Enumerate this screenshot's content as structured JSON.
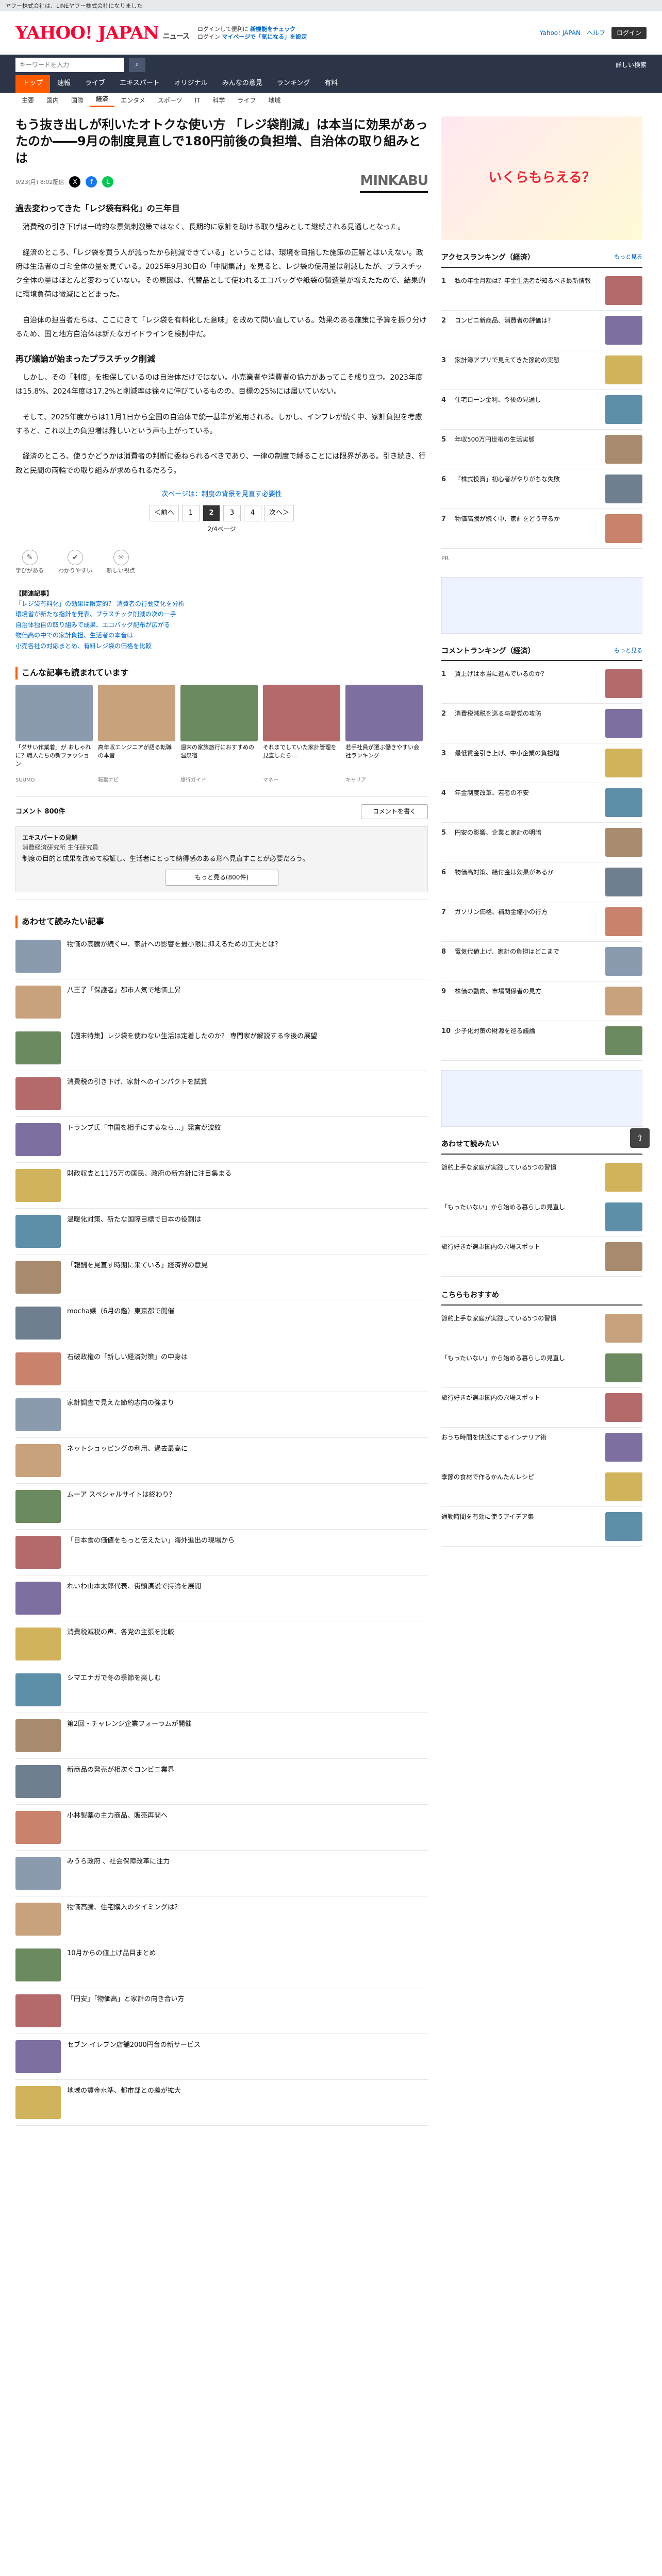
{
  "top_bar": "ヤフー株式会社は、LINEヤフー株式会社になりました",
  "header": {
    "logo": "YAHOO! JAPAN",
    "logo_sub": "ニュース",
    "promo1": "ログインして便利に",
    "promo1_b": "新機能をチェック",
    "promo2": "ログイン",
    "promo2_b": "マイページで「気になる」を設定",
    "right1": "Yahoo! JAPAN",
    "right2": "ヘルプ",
    "right_btn": "ログイン"
  },
  "search": {
    "placeholder": "キーワードを入力",
    "button": "検索",
    "option": "詳しい検索"
  },
  "nav1": [
    "トップ",
    "速報",
    "ライブ",
    "エキスパート",
    "オリジナル",
    "みんなの意見",
    "ランキング",
    "有料"
  ],
  "nav2": [
    "主要",
    "国内",
    "国際",
    "経済",
    "エンタメ",
    "スポーツ",
    "IT",
    "科学",
    "ライフ",
    "地域"
  ],
  "article": {
    "title": "もう抜き出しが利いたオトクな使い方 「レジ袋削減」は本当に効果があったのか――9月の制度見直しで180円前後の負担増、自治体の取り組みとは",
    "date": "9/23(月) 8:02配信",
    "source": "MINKABU",
    "h1": "過去変わってきた「レジ袋有料化」の三年目",
    "p1": "消費税の引き下げは一時的な景気刺激策ではなく、長期的に家計を助ける取り組みとして継続される見通しとなった。",
    "p2": "経済のところ、「レジ袋を買う人が減ったから削減できている」ということは、環境を目指した施策の正解とはいえない。政府は生活者のゴミ全体の量を見ている。2025年9月30日の「中間集計」を見ると、レジ袋の使用量は削減したが、プラスチック全体の量はほとんど変わっていない。その原因は、代替品として使われるエコバッグや紙袋の製造量が増えたためで、結果的に環境負荷は微減にとどまった。",
    "p3": "自治体の担当者たちは、ここにきて「レジ袋を有料化した意味」を改めて問い直している。効果のある施策に予算を振り分けるため、国と地方自治体は新たなガイドラインを検討中だ。",
    "h2": "再び議論が始まったプラスチック削減",
    "p4": "しかし、その「制度」を担保しているのは自治体だけではない。小売業者や消費者の協力があってこそ成り立つ。2023年度は15.8%、2024年度は17.2%と削減率は徐々に伸びているものの、目標の25%には届いていない。",
    "p5": "そして、2025年度からは11月1日から全国の自治体で統一基準が適用される。しかし、インフレが続く中、家計負担を考慮すると、これ以上の負担増は難しいという声も上がっている。",
    "p6": "経済のところ、使うかどうかは消費者の判断に委ねられるべきであり、一律の制度で縛ることには限界がある。引き続き、行政と民間の両輪での取り組みが求められるだろう。",
    "continue": "次ページは：制度の背景を見直す必要性",
    "pages": [
      "＜前へ",
      "1",
      "2",
      "3",
      "4",
      "次へ＞"
    ],
    "page_count": "2/4ページ",
    "reactions": [
      "学びがある",
      "わかりやすい",
      "新しい視点"
    ],
    "links_head": "【関連記事】",
    "links": [
      "「レジ袋有料化」の効果は限定的？ 消費者の行動変化を分析",
      "環境省が新たな指針を発表、プラスチック削減の次の一手",
      "自治体独自の取り組みで成果、エコバッグ配布が広がる",
      "物価高の中での家計負担、生活者の本音は",
      "小売各社の対応まとめ、有料レジ袋の価格を比較"
    ],
    "photos_head": "こんな記事も読まれています",
    "photos": [
      {
        "cap": "「ダサい作業着」が おしゃれに？職人たちの新ファッション",
        "src": "SUUMO"
      },
      {
        "cap": "高年収エンジニアが語る転職の本音",
        "src": "転職ナビ"
      },
      {
        "cap": "週末の家族旅行におすすめの温泉宿",
        "src": "旅行ガイド"
      },
      {
        "cap": "それまでしていた家計管理を見直したら…",
        "src": "マネー"
      },
      {
        "cap": "若手社員が選ぶ働きやすい会社ランキング",
        "src": "キャリア"
      }
    ],
    "comment_label": "コメント 800件",
    "comment_btn": "コメントを書く",
    "expert_head": "エキスパートの見解",
    "expert_name": "消費経済研究所 主任研究員",
    "expert_text": "制度の目的と成果を改めて検証し、生活者にとって納得感のある形へ見直すことが必要だろう。",
    "expert_more": "もっと見る(800件)",
    "related_head": "あわせて読みたい記事"
  },
  "related": [
    "物価の高騰が続く中、家計への影響を最小限に抑えるための工夫とは？",
    "八王子「保護者」都市人気で地価上昇",
    "【週末特集】レジ袋を使わない生活は定着したのか？ 専門家が解説する今後の展望",
    "消費税の引き下げ、家計へのインパクトを試算",
    "トランプ氏「中国を相手にするなら…」発言が波紋",
    "財政収支と1175万の国民、政府の新方針に注目集まる",
    "温暖化対策、新たな国際目標で日本の役割は",
    "「報酬を見直す時期に来ている」経済界の意見",
    "mocha嬢（6月の鑑）東京都で開催",
    "石破政権の「新しい経済対策」の中身は",
    "家計調査で見えた節約志向の強まり",
    "ネットショッピングの利用、過去最高に",
    "ムーア スペシャルサイトは終わり？",
    "「日本食の価値をもっと伝えたい」海外進出の現場から",
    "れいわ山本太郎代表、街頭演説で持論を展開",
    "消費税減税の声、各党の主張を比較",
    "シマエナガで冬の季節を楽しむ",
    "第2回・チャレンジ企業フォーラムが開催",
    "新商品の発売が相次ぐコンビニ業界",
    "小林製薬の主力商品、販売再開へ",
    "みうら政府 、社会保障改革に注力",
    "物価高騰、住宅購入のタイミングは？",
    "10月からの値上げ品目まとめ",
    "「円安」「物価高」と家計の向き合い方",
    "セブン-イレブン店舗2000円台の新サービス",
    "地域の賃金水準、都市部との差が拡大"
  ],
  "side": {
    "ad": "いくらもらえる？",
    "access_head": "アクセスランキング（経済）",
    "access_more": "もっと見る",
    "access": [
      "私の年金月額は？年金生活者が知るべき最新情報",
      "コンビニ新商品、消費者の評価は？",
      "家計簿アプリで見えてきた節約の実態",
      "住宅ローン金利、今後の見通し",
      "年収500万円世帯の生活実態",
      "「株式投資」初心者がやりがちな失敗",
      "物価高騰が続く中、家計をどう守るか"
    ],
    "comment_head": "コメントランキング（経済）",
    "comment": [
      "賃上げは本当に進んでいるのか？",
      "消費税減税を巡る与野党の攻防",
      "最低賃金引き上げ、中小企業の負担増",
      "年金制度改革、若者の不安",
      "円安の影響、企業と家計の明暗",
      "物価高対策、給付金は効果があるか",
      "ガソリン価格、補助金縮小の行方",
      "電気代値上げ、家計の負担はどこまで",
      "株価の動向、市場関係者の見方",
      "少子化対策の財源を巡る議論"
    ],
    "pickup_head": "あわせて読みたい",
    "rec_head": "こちらもおすすめ",
    "rec": [
      "節約上手な家庭が実践している5つの習慣",
      "「もったいない」から始める暮らしの見直し",
      "旅行好きが選ぶ国内の穴場スポット",
      "おうち時間を快適にするインテリア術",
      "季節の食材で作るかんたんレシピ",
      "通勤時間を有効に使うアイデア集"
    ],
    "pr": "PR"
  }
}
